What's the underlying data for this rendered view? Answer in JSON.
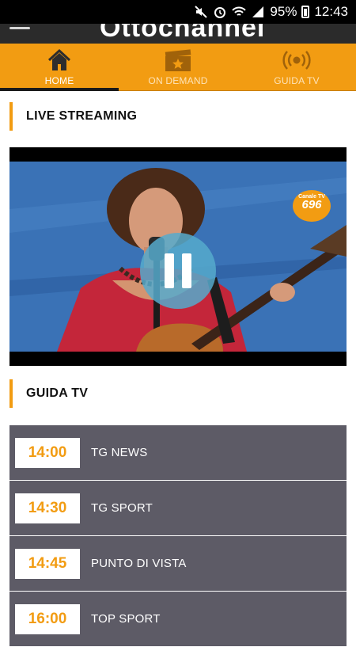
{
  "status_bar": {
    "battery": "95%",
    "time": "12:43"
  },
  "header": {
    "logo_text": "Ottochannel"
  },
  "tabs": [
    {
      "label": "HOME",
      "icon": "home-icon",
      "active": true
    },
    {
      "label": "ON DEMAND",
      "icon": "clapperboard-star-icon",
      "active": false
    },
    {
      "label": "GUIDA TV",
      "icon": "broadcast-icon",
      "active": false
    }
  ],
  "sections": {
    "live": "LIVE STREAMING",
    "guide": "GUIDA TV"
  },
  "player": {
    "badge_caption": "Canale TV",
    "badge_number": "696",
    "state_icon": "pause-icon"
  },
  "guide": [
    {
      "time": "14:00",
      "title": "TG NEWS"
    },
    {
      "time": "14:30",
      "title": "TG SPORT"
    },
    {
      "time": "14:45",
      "title": "PUNTO DI VISTA"
    },
    {
      "time": "16:00",
      "title": "TOP SPORT"
    }
  ],
  "colors": {
    "accent": "#f29c12",
    "guide_row": "#5d5b66",
    "header_dark": "#2b2b2b"
  }
}
